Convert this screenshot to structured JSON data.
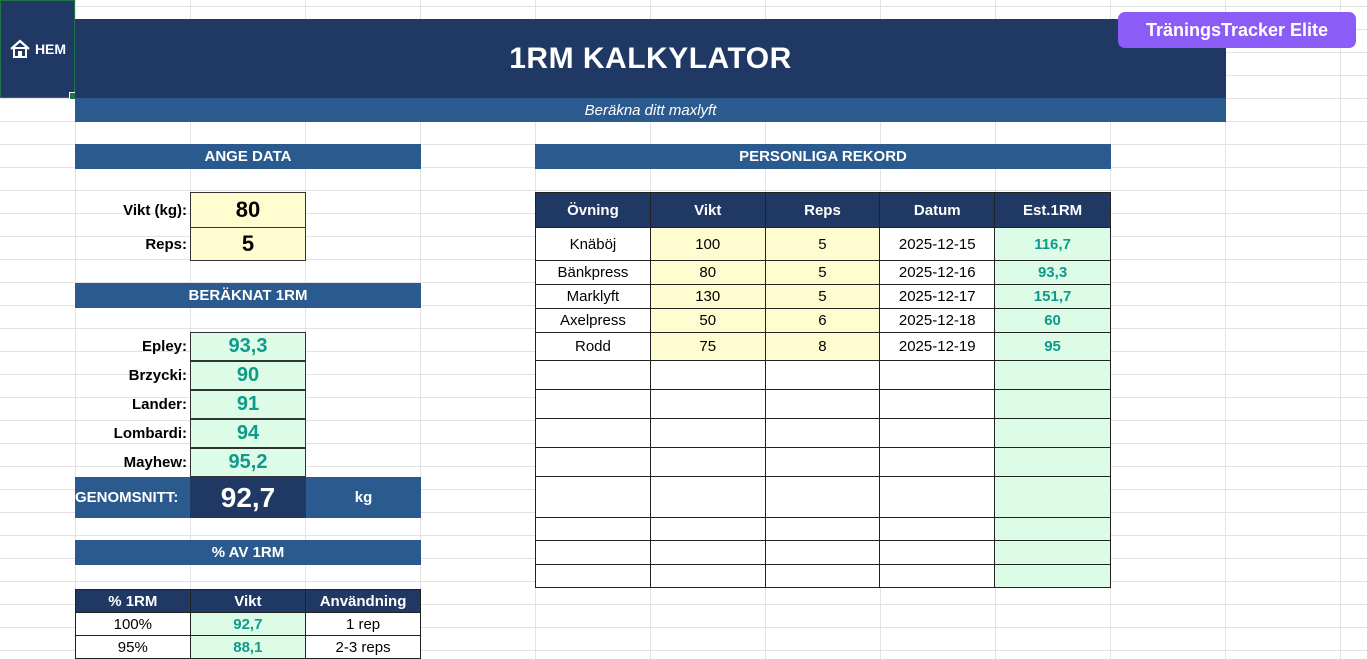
{
  "home": {
    "label": "HEM",
    "icon": "home-icon"
  },
  "header": {
    "title": "1RM KALKYLATOR",
    "subtitle": "Beräkna ditt maxlyft"
  },
  "brand": {
    "label": "TräningsTracker Elite"
  },
  "input_section": {
    "title": "ANGE DATA",
    "weight_label": "Vikt (kg):",
    "weight_value": "80",
    "reps_label": "Reps:",
    "reps_value": "5"
  },
  "results_section": {
    "title": "BERÄKNAT 1RM",
    "rows": [
      {
        "label": "Epley:",
        "value": "93,3"
      },
      {
        "label": "Brzycki:",
        "value": "90"
      },
      {
        "label": "Lander:",
        "value": "91"
      },
      {
        "label": "Lombardi:",
        "value": "94"
      },
      {
        "label": "Mayhew:",
        "value": "95,2"
      }
    ],
    "average_label": "GENOMSNITT:",
    "average_value": "92,7",
    "average_unit": "kg"
  },
  "percent_section": {
    "title": "% AV 1RM",
    "headers": [
      "% 1RM",
      "Vikt",
      "Användning"
    ],
    "rows": [
      {
        "pct": "100%",
        "weight": "92,7",
        "use": "1 rep"
      },
      {
        "pct": "95%",
        "weight": "88,1",
        "use": "2-3 reps"
      }
    ]
  },
  "records_section": {
    "title": "PERSONLIGA REKORD",
    "headers": [
      "Övning",
      "Vikt",
      "Reps",
      "Datum",
      "Est.1RM"
    ],
    "rows": [
      {
        "exercise": "Knäböj",
        "weight": "100",
        "reps": "5",
        "date": "2025-12-15",
        "est": "116,7"
      },
      {
        "exercise": "Bänkpress",
        "weight": "80",
        "reps": "5",
        "date": "2025-12-16",
        "est": "93,3"
      },
      {
        "exercise": "Marklyft",
        "weight": "130",
        "reps": "5",
        "date": "2025-12-17",
        "est": "151,7"
      },
      {
        "exercise": "Axelpress",
        "weight": "50",
        "reps": "6",
        "date": "2025-12-18",
        "est": "60"
      },
      {
        "exercise": "Rodd",
        "weight": "75",
        "reps": "8",
        "date": "2025-12-19",
        "est": "95"
      }
    ]
  },
  "colors": {
    "navy": "#1f3864",
    "blue": "#2b5a8f",
    "input": "#fffdd0",
    "result": "#dcfce7",
    "teal": "#0f9a8c",
    "brand": "#8b5cf6"
  }
}
